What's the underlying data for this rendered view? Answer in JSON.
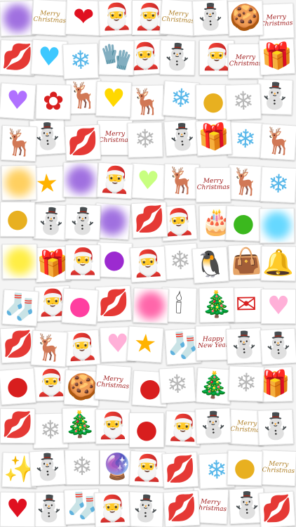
{
  "palette": {
    "purple_blur": "#a070e0",
    "yellow_blur": "#ffee44",
    "pink_blur": "#ff66aa",
    "aqua_blur": "#66d8ff",
    "gold_blur": "#ffd060",
    "lips": "#d21a3c",
    "lips_purple": "#c020d0",
    "lips_orange": "#ff6a1a",
    "heart_blue": "#3ec8ff",
    "heart_pink": "#ffb0d8",
    "heart_purple": "#b070ff",
    "heart_lime": "#c8ff80",
    "heart_red": "#e01020",
    "heart_yellow": "#ffd800",
    "snow_blue": "#59b8ea",
    "snow_gray": "#b8b8b8",
    "ornament_red": "#d81e1e",
    "ornament_gold": "#e8b020",
    "ornament_green": "#3bb81e",
    "ornament_purple": "#9c2ad0",
    "ornament_pink": "#ff3ea0",
    "star_gold": "#ffb300"
  },
  "captions": {
    "merry_christmas": "Merry\nChristmas",
    "happy_new_year": "Happy\nNew Year",
    "merry_christmas_short": "Merry Christmas"
  },
  "stickers": [
    {
      "kind": "blur",
      "color": "purple_blur",
      "icon": "purple-glow"
    },
    {
      "kind": "script",
      "text_key": "merry_christmas_short",
      "icon": "merry-christmas-text"
    },
    {
      "kind": "emoji",
      "glyph": "❤",
      "color": "heart_red",
      "icon": "flaming-heart"
    },
    {
      "kind": "emoji",
      "glyph": "🎅",
      "icon": "santa-face"
    },
    {
      "kind": "emoji",
      "glyph": "🎅",
      "icon": "santa-hat"
    },
    {
      "kind": "script",
      "text_key": "merry_christmas",
      "icon": "merry-christmas-text"
    },
    {
      "kind": "emoji",
      "glyph": "⛄",
      "icon": "snowman"
    },
    {
      "kind": "emoji",
      "glyph": "🍪",
      "icon": "gingerbread-man"
    },
    {
      "kind": "script",
      "text_key": "merry_christmas",
      "icon": "merry-christmas-text"
    },
    {
      "kind": "emoji",
      "glyph": "💋",
      "color": "lips",
      "icon": "red-lips"
    },
    {
      "kind": "emoji",
      "glyph": "♥",
      "color": "heart_blue",
      "icon": "blue-heart"
    },
    {
      "kind": "emoji",
      "glyph": "❄",
      "color": "snow_blue",
      "icon": "blue-snowflake"
    },
    {
      "kind": "emoji",
      "glyph": "🧤",
      "icon": "red-mitten"
    },
    {
      "kind": "emoji",
      "glyph": "🎅",
      "icon": "santa-hat"
    },
    {
      "kind": "emoji",
      "glyph": "⛄",
      "icon": "snowman"
    },
    {
      "kind": "emoji",
      "glyph": "🎅",
      "icon": "santa"
    },
    {
      "kind": "script",
      "text_key": "merry_christmas",
      "icon": "merry-christmas-text"
    },
    {
      "kind": "emoji",
      "glyph": "🎁",
      "color": "ornament_red",
      "icon": "gift-sack"
    },
    {
      "kind": "emoji",
      "glyph": "♥",
      "color": "heart_purple",
      "icon": "purple-heart"
    },
    {
      "kind": "emoji",
      "glyph": "✿",
      "color": "ornament_red",
      "icon": "poinsettia"
    },
    {
      "kind": "emoji",
      "glyph": "🦌",
      "icon": "reindeer"
    },
    {
      "kind": "emoji",
      "glyph": "♥",
      "color": "heart_yellow",
      "icon": "yellow-heart"
    },
    {
      "kind": "emoji",
      "glyph": "🦌",
      "color": "ornament_red",
      "icon": "antlers"
    },
    {
      "kind": "emoji",
      "glyph": "❄",
      "color": "snow_blue",
      "icon": "blue-snowflake"
    },
    {
      "kind": "emoji",
      "glyph": "●",
      "color": "ornament_gold",
      "icon": "gold-ornament"
    },
    {
      "kind": "emoji",
      "glyph": "❄",
      "color": "snow_gray",
      "icon": "gray-snowflake"
    },
    {
      "kind": "emoji",
      "glyph": "⛄",
      "icon": "snowman"
    },
    {
      "kind": "emoji",
      "glyph": "🦌",
      "icon": "reindeer"
    },
    {
      "kind": "emoji",
      "glyph": "⛄",
      "icon": "snowman"
    },
    {
      "kind": "emoji",
      "glyph": "💋",
      "color": "lips_orange",
      "icon": "orange-lips"
    },
    {
      "kind": "script",
      "text_key": "merry_christmas",
      "icon": "merry-christmas-text"
    },
    {
      "kind": "emoji",
      "glyph": "❄",
      "color": "snow_gray",
      "icon": "gray-snowflake"
    },
    {
      "kind": "emoji",
      "glyph": "⛄",
      "icon": "snowman"
    },
    {
      "kind": "emoji",
      "glyph": "🎁",
      "icon": "present-box"
    },
    {
      "kind": "emoji",
      "glyph": "❄",
      "color": "snow_blue",
      "icon": "blue-snowflake"
    },
    {
      "kind": "emoji",
      "glyph": "🦌",
      "color": "ornament_red",
      "icon": "antlers"
    },
    {
      "kind": "blur",
      "color": "gold_blur",
      "icon": "gold-glow"
    },
    {
      "kind": "emoji",
      "glyph": "★",
      "color": "star_gold",
      "icon": "gold-star"
    },
    {
      "kind": "blur",
      "color": "purple_blur",
      "icon": "purple-glow"
    },
    {
      "kind": "emoji",
      "glyph": "🎅",
      "icon": "santa-hat"
    },
    {
      "kind": "emoji",
      "glyph": "♥",
      "color": "heart_lime",
      "icon": "lime-heart"
    },
    {
      "kind": "emoji",
      "glyph": "🦌",
      "icon": "reindeer"
    },
    {
      "kind": "script",
      "text_key": "merry_christmas_short",
      "icon": "merry-christmas-text"
    },
    {
      "kind": "emoji",
      "glyph": "🦌",
      "icon": "reindeer"
    },
    {
      "kind": "emoji",
      "glyph": "❄",
      "color": "snow_blue",
      "icon": "blue-snowflake"
    },
    {
      "kind": "emoji",
      "glyph": "●",
      "color": "ornament_gold",
      "icon": "gold-ornament"
    },
    {
      "kind": "emoji",
      "glyph": "⛄",
      "icon": "snowman"
    },
    {
      "kind": "emoji",
      "glyph": "⛄",
      "icon": "snowman-sled"
    },
    {
      "kind": "blur",
      "color": "purple_blur",
      "icon": "purple-glow"
    },
    {
      "kind": "emoji",
      "glyph": "💋",
      "color": "lips_purple",
      "icon": "purple-lips"
    },
    {
      "kind": "emoji",
      "glyph": "🎅",
      "icon": "santa-hat"
    },
    {
      "kind": "emoji",
      "glyph": "🎂",
      "icon": "christmas-cake"
    },
    {
      "kind": "emoji",
      "glyph": "●",
      "color": "ornament_green",
      "icon": "green-ornament"
    },
    {
      "kind": "blur",
      "color": "aqua_blur",
      "icon": "aqua-glow"
    },
    {
      "kind": "blur",
      "color": "yellow_blur",
      "icon": "yellow-glow"
    },
    {
      "kind": "emoji",
      "glyph": "🎁",
      "color": "ornament_red",
      "icon": "gift-bag"
    },
    {
      "kind": "emoji",
      "glyph": "🎅",
      "icon": "santa"
    },
    {
      "kind": "emoji",
      "glyph": "●",
      "color": "ornament_purple",
      "icon": "purple-ornament"
    },
    {
      "kind": "emoji",
      "glyph": "🎅",
      "icon": "santa"
    },
    {
      "kind": "emoji",
      "glyph": "❄",
      "color": "snow_gray",
      "icon": "gray-snowflake"
    },
    {
      "kind": "emoji",
      "glyph": "🐧",
      "icon": "penguin"
    },
    {
      "kind": "emoji",
      "glyph": "👜",
      "color": "snow_blue",
      "icon": "blue-gift-bag"
    },
    {
      "kind": "emoji",
      "glyph": "🔔",
      "icon": "christmas-bells"
    },
    {
      "kind": "emoji",
      "glyph": "🧦",
      "icon": "christmas-stocking"
    },
    {
      "kind": "emoji",
      "glyph": "🎅",
      "icon": "santa"
    },
    {
      "kind": "emoji",
      "glyph": "●",
      "color": "ornament_pink",
      "icon": "pink-ornament"
    },
    {
      "kind": "emoji",
      "glyph": "💋",
      "color": "lips_purple",
      "icon": "purple-lips"
    },
    {
      "kind": "blur",
      "color": "pink_blur",
      "icon": "pink-glow"
    },
    {
      "kind": "emoji",
      "glyph": "🕯",
      "icon": "candles"
    },
    {
      "kind": "emoji",
      "glyph": "🎄",
      "icon": "christmas-wreath"
    },
    {
      "kind": "emoji",
      "glyph": "✉",
      "color": "ornament_red",
      "icon": "christmas-postcard"
    },
    {
      "kind": "emoji",
      "glyph": "♥",
      "color": "heart_pink",
      "icon": "pink-heart"
    },
    {
      "kind": "emoji",
      "glyph": "💋",
      "color": "lips_purple",
      "icon": "purple-lips"
    },
    {
      "kind": "emoji",
      "glyph": "🦌",
      "icon": "reindeer"
    },
    {
      "kind": "emoji",
      "glyph": "🎅",
      "icon": "santa"
    },
    {
      "kind": "emoji",
      "glyph": "♥",
      "color": "heart_pink",
      "icon": "pink-heart"
    },
    {
      "kind": "emoji",
      "glyph": "★",
      "color": "star_gold",
      "icon": "smiling-star"
    },
    {
      "kind": "emoji",
      "glyph": "🧦",
      "icon": "christmas-stocking"
    },
    {
      "kind": "script",
      "text_key": "happy_new_year",
      "icon": "happy-new-year-text"
    },
    {
      "kind": "emoji",
      "glyph": "⛄",
      "icon": "snowman"
    },
    {
      "kind": "emoji",
      "glyph": "⛄",
      "icon": "snowman"
    },
    {
      "kind": "emoji",
      "glyph": "●",
      "color": "ornament_red",
      "icon": "red-ornament"
    },
    {
      "kind": "emoji",
      "glyph": "🎅",
      "icon": "santa"
    },
    {
      "kind": "emoji",
      "glyph": "🍪",
      "icon": "heart-cookies"
    },
    {
      "kind": "script",
      "text_key": "merry_christmas",
      "icon": "merry-christmas-text"
    },
    {
      "kind": "emoji",
      "glyph": "●",
      "color": "ornament_red",
      "icon": "red-ornament"
    },
    {
      "kind": "emoji",
      "glyph": "❄",
      "color": "snow_gray",
      "icon": "gray-snowflake"
    },
    {
      "kind": "emoji",
      "glyph": "🎄",
      "icon": "christmas-tree"
    },
    {
      "kind": "emoji",
      "glyph": "❄",
      "color": "snow_gray",
      "icon": "gray-snowflake"
    },
    {
      "kind": "emoji",
      "glyph": "🎁",
      "icon": "present-box"
    },
    {
      "kind": "emoji",
      "glyph": "💋",
      "color": "lips_purple",
      "icon": "purple-lips"
    },
    {
      "kind": "emoji",
      "glyph": "❄",
      "color": "snow_gray",
      "icon": "gray-snowflake"
    },
    {
      "kind": "emoji",
      "glyph": "🎄",
      "icon": "christmas-tree"
    },
    {
      "kind": "emoji",
      "glyph": "🎅",
      "icon": "santa-hat"
    },
    {
      "kind": "emoji",
      "glyph": "●",
      "color": "ornament_red",
      "icon": "red-ornament"
    },
    {
      "kind": "emoji",
      "glyph": "🎅",
      "icon": "santa"
    },
    {
      "kind": "emoji",
      "glyph": "⛄",
      "icon": "snowman"
    },
    {
      "kind": "script",
      "text_key": "merry_christmas_short",
      "icon": "merry-christmas-text"
    },
    {
      "kind": "emoji",
      "glyph": "⛄",
      "icon": "snowman"
    },
    {
      "kind": "emoji",
      "glyph": "✨",
      "icon": "confetti"
    },
    {
      "kind": "emoji",
      "glyph": "⛄",
      "icon": "snowman"
    },
    {
      "kind": "emoji",
      "glyph": "❄",
      "color": "snow_gray",
      "icon": "gray-snowflake"
    },
    {
      "kind": "emoji",
      "glyph": "🔮",
      "icon": "snow-globe"
    },
    {
      "kind": "emoji",
      "glyph": "🎅",
      "icon": "santa-hat"
    },
    {
      "kind": "emoji",
      "glyph": "💋",
      "color": "lips_orange",
      "icon": "orange-lips"
    },
    {
      "kind": "emoji",
      "glyph": "❄",
      "color": "snow_blue",
      "icon": "blue-snowflake"
    },
    {
      "kind": "emoji",
      "glyph": "●",
      "color": "ornament_gold",
      "icon": "gold-ornament"
    },
    {
      "kind": "script",
      "text_key": "merry_christmas",
      "icon": "merry-christmas-text"
    },
    {
      "kind": "emoji",
      "glyph": "♥",
      "color": "heart_red",
      "icon": "heart-with-arrow"
    },
    {
      "kind": "emoji",
      "glyph": "⛄",
      "icon": "snowman"
    },
    {
      "kind": "emoji",
      "glyph": "🧦",
      "icon": "christmas-stocking"
    },
    {
      "kind": "emoji",
      "glyph": "🎅",
      "icon": "santa"
    },
    {
      "kind": "emoji",
      "glyph": "⛄",
      "icon": "snowman"
    },
    {
      "kind": "emoji",
      "glyph": "💋",
      "color": "lips_orange",
      "icon": "orange-lips"
    },
    {
      "kind": "script",
      "text_key": "merry_christmas",
      "icon": "merry-christmas-text"
    },
    {
      "kind": "emoji",
      "glyph": "⛄",
      "icon": "snowman"
    },
    {
      "kind": "emoji",
      "glyph": "💋",
      "color": "lips_purple",
      "icon": "purple-lips"
    }
  ]
}
